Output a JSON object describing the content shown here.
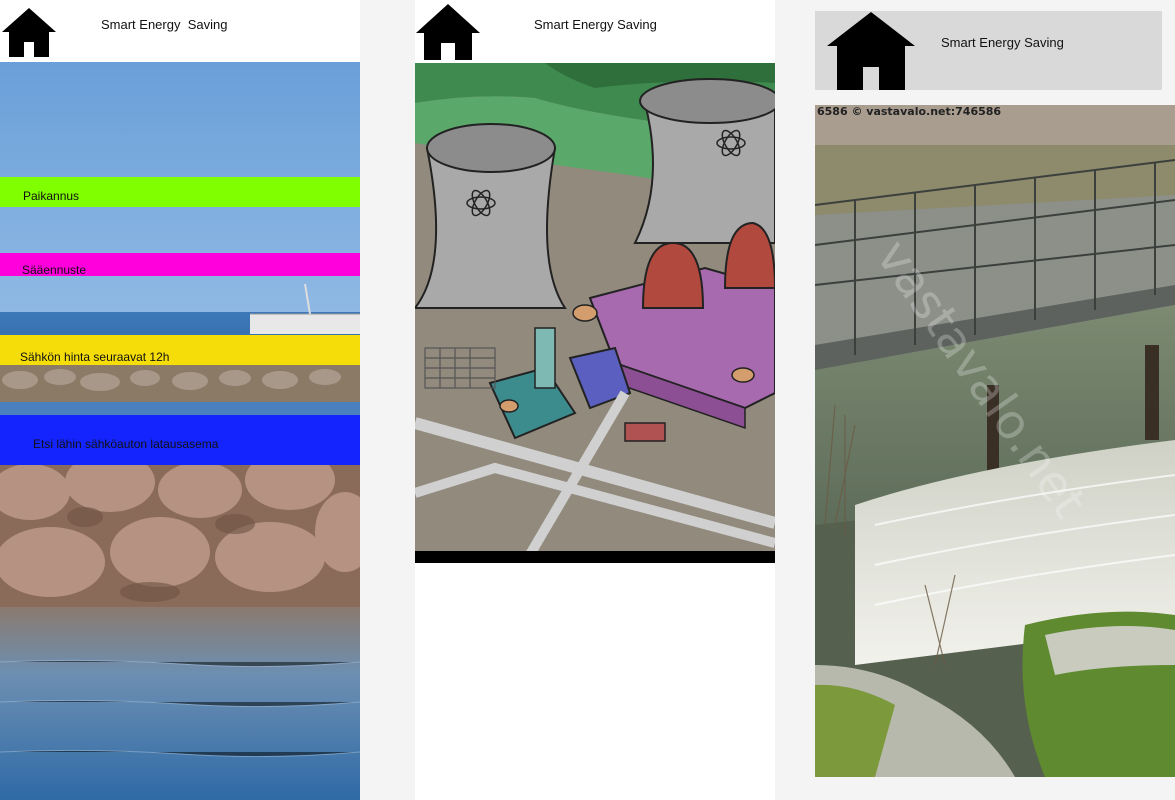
{
  "screens": [
    {
      "header": {
        "title": "Smart Energy  Saving",
        "home_icon": "home-icon"
      },
      "menu": [
        {
          "label": "Paikannus",
          "color": "#7fff00"
        },
        {
          "label": "Sääennuste",
          "color": "#ff00dd"
        },
        {
          "label": "Sähkön hinta seuraavat 12h",
          "color": "#f5dd0a"
        },
        {
          "label": "Etsi lähin sähköauton latausasema",
          "color": "#1424ff"
        }
      ]
    },
    {
      "header": {
        "title": "Smart Energy Saving",
        "home_icon": "home-icon"
      }
    },
    {
      "header": {
        "title": "Smart Energy Saving",
        "home_icon": "home-icon"
      },
      "photo": {
        "watermark": "6586 © vastavalo.net:746586"
      }
    }
  ]
}
